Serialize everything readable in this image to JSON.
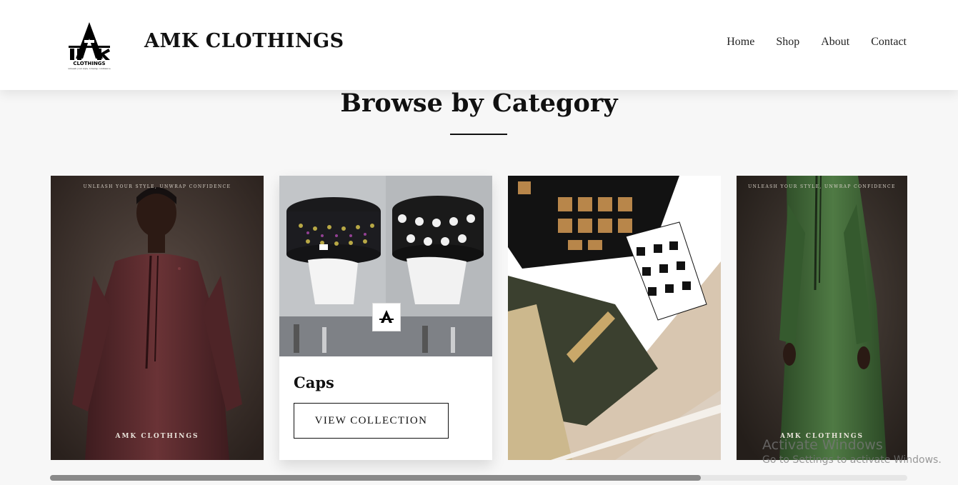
{
  "header": {
    "brand": "AMK CLOTHINGS",
    "logo_text": "CLOTHINGS",
    "logo_tagline": "unleash your style. Unwrap confidence",
    "nav": [
      "Home",
      "Shop",
      "About",
      "Contact"
    ]
  },
  "section": {
    "title": "Browse by Category"
  },
  "cards": [
    {
      "promo": "UNLEASH YOUR STYLE, UNWRAP CONFIDENCE",
      "brand": "AMK CLOTHINGS",
      "garment_color": "#5a2a2c"
    },
    {
      "title": "Caps",
      "button": "VIEW COLLECTION"
    },
    {
      "colors": [
        "#101010",
        "#3b402f",
        "#ffffff",
        "#d8c6b0"
      ]
    },
    {
      "promo": "UNLEASH YOUR STYLE, UNWRAP CONFIDENCE",
      "brand": "AMK CLOTHINGS",
      "garment_color": "#3e6435"
    }
  ],
  "scrollbar": {
    "position_fraction": 0.76
  },
  "os_overlay": {
    "title": "Activate Windows",
    "subtitle": "Go to Settings to activate Windows."
  }
}
